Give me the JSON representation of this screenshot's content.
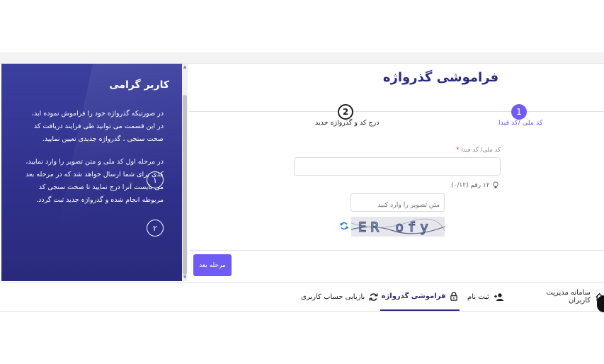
{
  "info_panel": {
    "title": "کاربر گرامی",
    "items": [
      {
        "number": "۱",
        "text": "در صورتیکه گذرواژه خود را فراموش نموده اید، در این قسمت می توانید طی فرایند دریافت کد صحت سنجی ، گذرواژه جدیدی تعیین نمایید."
      },
      {
        "number": "۲",
        "text": "در مرحله اول کد ملی و متن تصویر را وارد نمایید، کدی برای شما ارسال خواهد شد که در مرحله بعد می بایست آنرا درج نمایید تا صحت سنجی کد مربوطه انجام شده و گذرواژه جدید ثبت گردد."
      }
    ]
  },
  "form": {
    "title": "فراموشی گذرواژه",
    "steps": [
      {
        "number": "1",
        "label": "کد ملی /کد فیدا"
      },
      {
        "number": "2",
        "label": "درج کد و گذرواژه جدید"
      }
    ],
    "national_code_label": "کد ملی/ کد فیدا",
    "required_mark": "*",
    "national_code_value": "",
    "hint": "۱۲ رقم (۰/۱۲)",
    "captcha_placeholder": "متن تصویر را وارد کنید",
    "captcha_text": "ER ofy",
    "next_label": "مرحله بعد"
  },
  "tabs": [
    {
      "label": "سامانه مدیریت کاربران",
      "icon": "home-icon"
    },
    {
      "label": "ثبت نام",
      "icon": "add-user-icon"
    },
    {
      "label": "فراموشی گذرواژه",
      "icon": "lock-icon",
      "active": true
    },
    {
      "label": "بازیابی حساب کاربری",
      "icon": "sync-icon"
    }
  ],
  "colors": {
    "accent": "#6f5cf2",
    "navy": "#2c2c7f",
    "panel": "#30318c"
  }
}
